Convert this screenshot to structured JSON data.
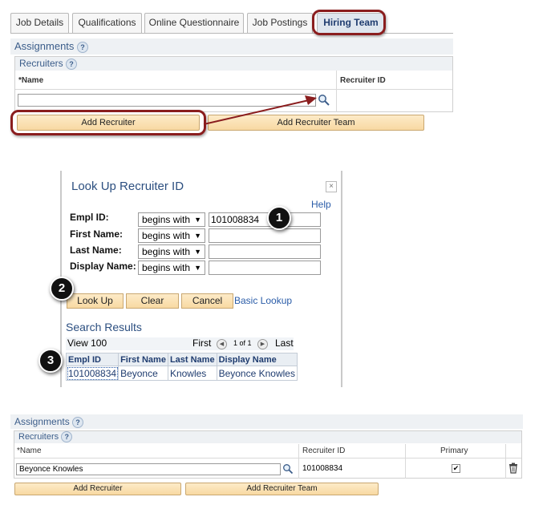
{
  "tabs": [
    {
      "label": "Job Details",
      "active": false
    },
    {
      "label": "Qualifications",
      "active": false
    },
    {
      "label": "Online Questionnaire",
      "active": false
    },
    {
      "label": "Job Postings",
      "active": false
    },
    {
      "label": "Hiring Team",
      "active": true
    }
  ],
  "top": {
    "assignments_title": "Assignments",
    "recruiters_title": "Recruiters",
    "help_glyph": "?",
    "col_name": "*Name",
    "col_recruiter_id": "Recruiter ID",
    "name_value": "",
    "add_recruiter": "Add Recruiter",
    "add_recruiter_team": "Add Recruiter Team"
  },
  "lookup": {
    "title": "Look Up Recruiter ID",
    "close_glyph": "×",
    "help": "Help",
    "fields": [
      {
        "label": "Empl ID:",
        "operator": "begins with",
        "value": "101008834"
      },
      {
        "label": "First Name:",
        "operator": "begins with",
        "value": ""
      },
      {
        "label": "Last Name:",
        "operator": "begins with",
        "value": ""
      },
      {
        "label": "Display Name:",
        "operator": "begins with",
        "value": ""
      }
    ],
    "buttons": {
      "look_up": "Look Up",
      "clear": "Clear",
      "cancel": "Cancel",
      "basic_lookup": "Basic Lookup"
    },
    "results_title": "Search Results",
    "view_100": "View 100",
    "nav": {
      "first": "First",
      "page": "1 of 1",
      "last": "Last"
    },
    "columns": [
      "Empl ID",
      "First Name",
      "Last Name",
      "Display Name"
    ],
    "rows": [
      [
        "101008834",
        "Beyonce",
        "Knowles",
        "Beyonce Knowles"
      ]
    ]
  },
  "steps": [
    "1",
    "2",
    "3"
  ],
  "bottom": {
    "assignments_title": "Assignments",
    "recruiters_title": "Recruiters",
    "help_glyph": "?",
    "col_name": "*Name",
    "col_recruiter_id": "Recruiter ID",
    "col_primary": "Primary",
    "row": {
      "name": "Beyonce Knowles",
      "recruiter_id": "101008834",
      "primary": true
    },
    "add_recruiter": "Add Recruiter",
    "add_recruiter_team": "Add Recruiter Team"
  },
  "colors": {
    "accent_red": "#8a1d1e",
    "button_tan": "#f8d9a2",
    "link_blue": "#2a5ca8",
    "heading_blue": "#2c4f80"
  },
  "icons": {
    "lookup": "magnifier-icon",
    "delete": "trash-icon",
    "arrow": "callout-arrow"
  }
}
